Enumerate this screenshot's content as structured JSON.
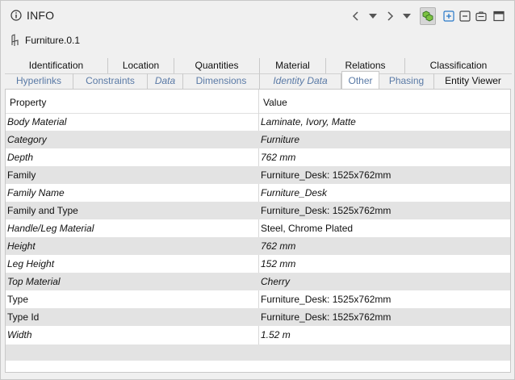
{
  "panel": {
    "title": "INFO",
    "entity_name": "Furniture.0.1"
  },
  "toolbar": {
    "icons": [
      "back-icon",
      "back-dropdown-icon",
      "forward-icon",
      "forward-dropdown-icon",
      "select-icon",
      "expand-all-icon",
      "collapse-all-icon",
      "briefcase-icon",
      "window-icon"
    ]
  },
  "tabs": {
    "row1": [
      "Identification",
      "Location",
      "Quantities",
      "Material",
      "Relations",
      "Classification"
    ],
    "row2": [
      "Hyperlinks",
      "Constraints",
      "Data",
      "Dimensions",
      "Identity Data",
      "Other",
      "Phasing",
      "Entity Viewer"
    ],
    "selected": "Other"
  },
  "grid": {
    "headers": {
      "property": "Property",
      "value": "Value"
    },
    "rows": [
      {
        "property": "Body Material",
        "value": "Laminate, Ivory, Matte"
      },
      {
        "property": "Category",
        "value": "Furniture"
      },
      {
        "property": "Depth",
        "value": "762 mm"
      },
      {
        "property": "Family",
        "value": "Furniture_Desk: 1525x762mm"
      },
      {
        "property": "Family Name",
        "value": "Furniture_Desk"
      },
      {
        "property": "Family and Type",
        "value": "Furniture_Desk: 1525x762mm"
      },
      {
        "property": "Handle/Leg Material",
        "value": "Steel, Chrome Plated"
      },
      {
        "property": "Height",
        "value": "762 mm"
      },
      {
        "property": "Leg Height",
        "value": "152 mm"
      },
      {
        "property": "Top Material",
        "value": "Cherry"
      },
      {
        "property": "Type",
        "value": "Furniture_Desk: 1525x762mm"
      },
      {
        "property": "Type Id",
        "value": "Furniture_Desk: 1525x762mm"
      },
      {
        "property": "Width",
        "value": "1.52 m"
      }
    ]
  }
}
